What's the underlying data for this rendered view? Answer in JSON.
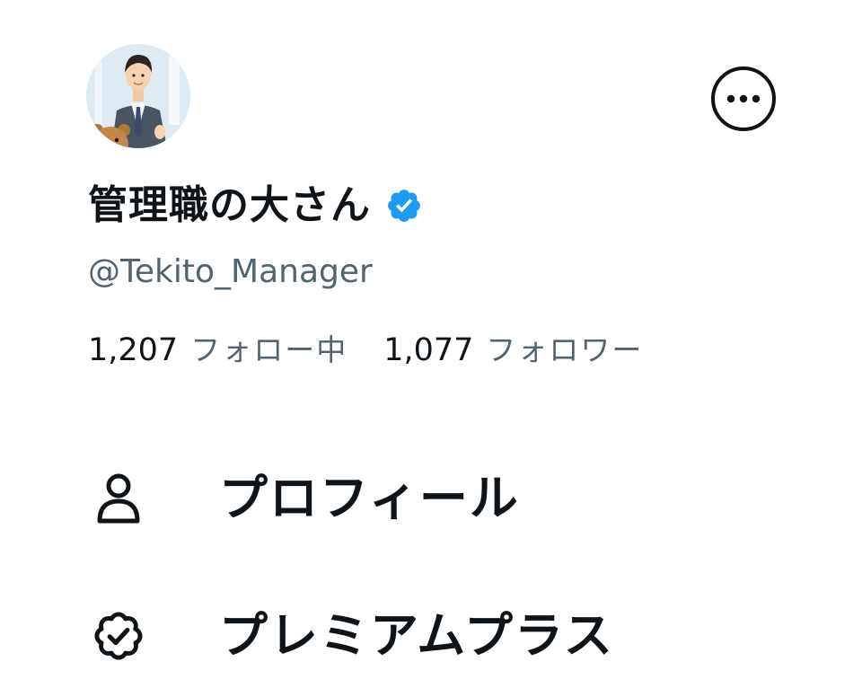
{
  "profile": {
    "display_name": "管理職の大さん",
    "handle": "@Tekito_Manager",
    "verified": true
  },
  "stats": {
    "following_count": "1,207",
    "following_label": "フォロー中",
    "followers_count": "1,077",
    "followers_label": "フォロワー"
  },
  "menu": {
    "items": [
      {
        "label": "プロフィール",
        "icon": "person-icon"
      },
      {
        "label": "プレミアムプラス",
        "icon": "verified-badge-outline-icon"
      }
    ]
  },
  "icons": {
    "more": "more-options-icon",
    "verified": "verified-badge-icon"
  },
  "colors": {
    "text_primary": "#0f1419",
    "text_secondary": "#536471",
    "verified_blue": "#1d9bf0"
  }
}
